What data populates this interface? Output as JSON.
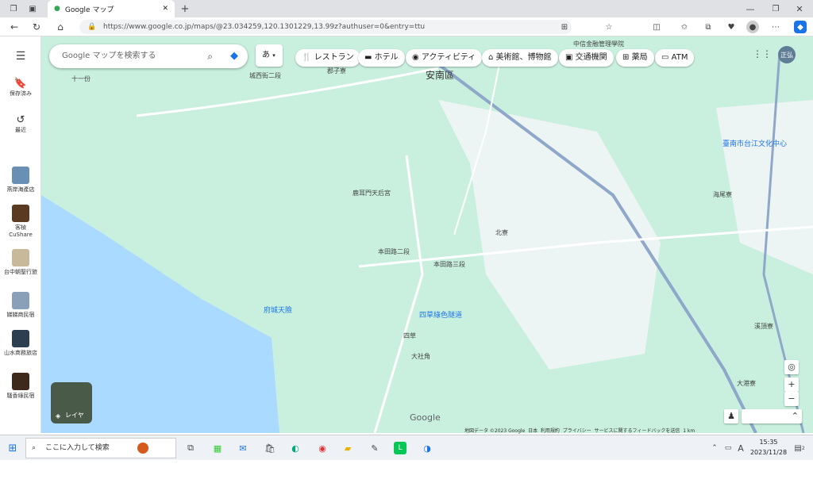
{
  "browser": {
    "tab_title": "Google マップ",
    "url": "https://www.google.co.jp/maps/@23.034259,120.1301229,13.99z?authuser=0&entry=ttu"
  },
  "search": {
    "placeholder": "Google マップを検索する",
    "lang_button": "あ"
  },
  "chips": [
    "レストラン",
    "ホテル",
    "アクティビティ",
    "美術館、博物館",
    "交通機関",
    "薬局",
    "ATM"
  ],
  "sidebar": {
    "saved": "保存済み",
    "recent": "最近",
    "places": [
      "燕岸海產店",
      "客楨 CuShare",
      "台中朝聖行旅",
      "娣娣商民宿",
      "山水商務旅店",
      "騷香綠民宿"
    ]
  },
  "map": {
    "district": "安南區",
    "labels": [
      "鹿耳門天后宮",
      "北寮",
      "本田路二段",
      "本田路三段",
      "四草",
      "大社角",
      "溪頂寮",
      "海尾寮",
      "大港寮",
      "郡子寮",
      "十一份",
      "城西街二段",
      "中信金融管理學院",
      "臺南市台江文化中心",
      "府城天險",
      "四草綠色隧道"
    ],
    "layer_label": "レイヤ",
    "user_initial": "正弘",
    "footer": [
      "地図データ ©2023 Google",
      "日本",
      "利用規約",
      "プライバシー",
      "サービスに関するフィードバックを送信",
      "1 km"
    ]
  },
  "taskbar": {
    "search_placeholder": "ここに入力して検索",
    "time": "15:35",
    "date": "2023/11/28",
    "ime": "A",
    "notification_count": "2"
  },
  "colors": {
    "map_land": "#c9f0df",
    "water": "#aadaff",
    "road": "#8fa7c9",
    "urban": "#f3f5f8"
  }
}
